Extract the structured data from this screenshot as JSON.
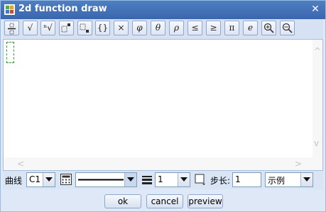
{
  "window": {
    "title": "2d function draw",
    "close_label": "✕"
  },
  "toolbar": {
    "buttons": [
      {
        "name": "fraction-icon",
        "label": ""
      },
      {
        "name": "sqrt-icon",
        "label": "√"
      },
      {
        "name": "nth-root-icon",
        "label": "ⁿ√"
      },
      {
        "name": "superscript-icon",
        "label": ""
      },
      {
        "name": "subscript-icon",
        "label": ""
      },
      {
        "name": "braces-icon",
        "label": "{}"
      },
      {
        "name": "times-icon",
        "label": "×"
      },
      {
        "name": "phi-icon",
        "label": "φ"
      },
      {
        "name": "theta-icon",
        "label": "θ"
      },
      {
        "name": "rho-icon",
        "label": "ρ"
      },
      {
        "name": "less-equal-icon",
        "label": "≤"
      },
      {
        "name": "greater-equal-icon",
        "label": "≥"
      },
      {
        "name": "pi-icon",
        "label": "π"
      },
      {
        "name": "e-icon",
        "label": "e"
      },
      {
        "name": "zoom-in-icon",
        "label": ""
      },
      {
        "name": "zoom-out-icon",
        "label": ""
      }
    ]
  },
  "editor": {
    "left_arrow": "<",
    "right_arrow": ">",
    "up_arrow": "^",
    "down_arrow": "v"
  },
  "options": {
    "curve_label": "曲线",
    "curve_value": "C1",
    "line_width_value": "1",
    "step_label": "步长:",
    "step_value": "1",
    "example_value": "示例"
  },
  "buttons": {
    "ok": "ok",
    "cancel": "cancel",
    "preview": "preview"
  }
}
